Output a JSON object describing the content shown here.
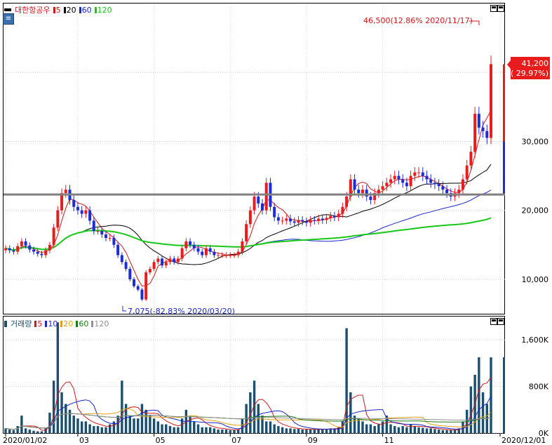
{
  "price_legend": {
    "name": "대한항공우",
    "items": [
      {
        "label": "5",
        "color": "#d01818"
      },
      {
        "label": "20",
        "color": "#000000"
      },
      {
        "label": "60",
        "color": "#1828c8"
      },
      {
        "label": "120",
        "color": "#18c818"
      }
    ]
  },
  "volume_legend": {
    "name": "거래량",
    "items": [
      {
        "label": "5",
        "color": "#d01818"
      },
      {
        "label": "10",
        "color": "#1828c8"
      },
      {
        "label": "20",
        "color": "#e0a018"
      },
      {
        "label": "60",
        "color": "#1a7a1a"
      },
      {
        "label": "120",
        "color": "#909090"
      }
    ]
  },
  "annotations": {
    "high": "46,500(12.86% 2020/11/17)",
    "low": "7,075(-82.83% 2020/03/20)",
    "current_price": "41,200",
    "current_change": "( 29.97%)"
  },
  "icons": {
    "settings": "chart-settings-icon",
    "window": "window-button-icon"
  },
  "colors": {
    "up": "#e81c1c",
    "down": "#1c2cd8",
    "volume": "#1a4f70",
    "hline": "#808080"
  },
  "chart_data": [
    {
      "type": "candlestick",
      "title": "대한항공우",
      "yticks": [
        "30,000",
        "20,000",
        "10,000"
      ],
      "ylim": [
        5000,
        50000
      ],
      "xticks": [
        "2020/01/02",
        "03",
        "05",
        "07",
        "09",
        "11",
        "2020/12/01"
      ],
      "horizontal_line": 22300,
      "series": [
        {
          "name": "대한항공우",
          "values": [
            14500,
            14200,
            14000,
            14800,
            15500,
            14900,
            14300,
            14000,
            13700,
            13500,
            14200,
            15000,
            17500,
            20000,
            22500,
            23000,
            21500,
            20500,
            20000,
            19500,
            20000,
            18500,
            17000,
            17000,
            16500,
            16000,
            16000,
            15000,
            13500,
            12500,
            11500,
            10000,
            9000,
            8500,
            7075,
            11000,
            11500,
            12500,
            13000,
            12000,
            12500,
            13000,
            12500,
            13000,
            14500,
            15500,
            15000,
            14500,
            14000,
            13500,
            14500,
            14000,
            13500,
            13500,
            13500,
            13500,
            13500,
            13500,
            14000,
            15500,
            18000,
            20000,
            22000,
            21000,
            20000,
            24000,
            20500,
            19000,
            18500,
            18500,
            18800,
            18400,
            18200,
            18600,
            18400,
            18200,
            18600,
            18500,
            18800,
            18600,
            18900,
            19200,
            19000,
            19500,
            20500,
            22000,
            24500,
            23000,
            22500,
            23000,
            22000,
            21500,
            22500,
            23000,
            23500,
            24000,
            24500,
            25000,
            24500,
            24000,
            23500,
            25000,
            25500,
            25500,
            25000,
            24500,
            24000,
            23800,
            23500,
            23000,
            22500,
            22000,
            22500,
            23000,
            24500,
            26500,
            28500,
            34000,
            32000,
            31500,
            30500,
            41200
          ]
        }
      ],
      "ma_values": {
        "5": [
          14500,
          14300,
          14200,
          14400,
          14700,
          14800,
          14600,
          14400,
          14100,
          13900,
          14000,
          14300,
          15000,
          16400,
          18500,
          20300,
          21700,
          21500,
          21100,
          20900,
          20600,
          19900,
          19000,
          18200,
          17400,
          16900,
          16500,
          16000,
          15400,
          14800,
          13900,
          12600,
          11300,
          10000,
          9000,
          9100,
          9400,
          10500,
          11900,
          12300,
          12600,
          12700,
          12600,
          12700,
          13100,
          13700,
          14100,
          14600,
          14700,
          14600,
          14300,
          14100,
          13900,
          13800,
          13700,
          13500,
          13500,
          13500,
          13600,
          14000,
          15000,
          16300,
          18100,
          19300,
          20200,
          21500,
          21500,
          20900,
          20400,
          20100,
          19500,
          18700,
          18600,
          18500,
          18400,
          18400,
          18400,
          18500,
          18500,
          18600,
          18700,
          18900,
          19000,
          19200,
          19600,
          20600,
          22100,
          23300,
          23900,
          24100,
          23900,
          23100,
          22800,
          22500,
          22800,
          23300,
          23800,
          24300,
          24500,
          24500,
          24400,
          24500,
          24700,
          24900,
          25000,
          24800,
          24500,
          24200,
          23900,
          23500,
          23100,
          22800,
          22600,
          22600,
          23000,
          24100,
          25800,
          28000,
          30200,
          32400,
          33400,
          34500
        ]
      }
    },
    {
      "type": "bar",
      "title": "거래량",
      "yticks": [
        "1,600K",
        "800K",
        "0K"
      ],
      "ylim": [
        0,
        2000
      ],
      "unit": "K",
      "series": [
        {
          "name": "거래량",
          "values": [
            80,
            60,
            50,
            120,
            300,
            80,
            60,
            40,
            30,
            30,
            90,
            350,
            900,
            1900,
            700,
            500,
            400,
            300,
            250,
            200,
            200,
            150,
            120,
            120,
            100,
            100,
            150,
            200,
            300,
            900,
            500,
            300,
            250,
            250,
            500,
            400,
            300,
            250,
            200,
            150,
            150,
            120,
            100,
            100,
            250,
            400,
            300,
            200,
            150,
            100,
            100,
            100,
            80,
            60,
            60,
            60,
            50,
            50,
            60,
            250,
            500,
            700,
            900,
            500,
            300,
            200,
            200,
            150,
            120,
            100,
            80,
            80,
            70,
            70,
            60,
            60,
            60,
            60,
            70,
            70,
            70,
            80,
            80,
            100,
            200,
            1800,
            700,
            300,
            250,
            200,
            150,
            150,
            120,
            150,
            200,
            300,
            150,
            120,
            100,
            120,
            100,
            150,
            120,
            100,
            90,
            80,
            80,
            70,
            60,
            50,
            50,
            50,
            60,
            80,
            200,
            400,
            800,
            1000,
            1300,
            700,
            500,
            1300
          ]
        }
      ]
    }
  ]
}
